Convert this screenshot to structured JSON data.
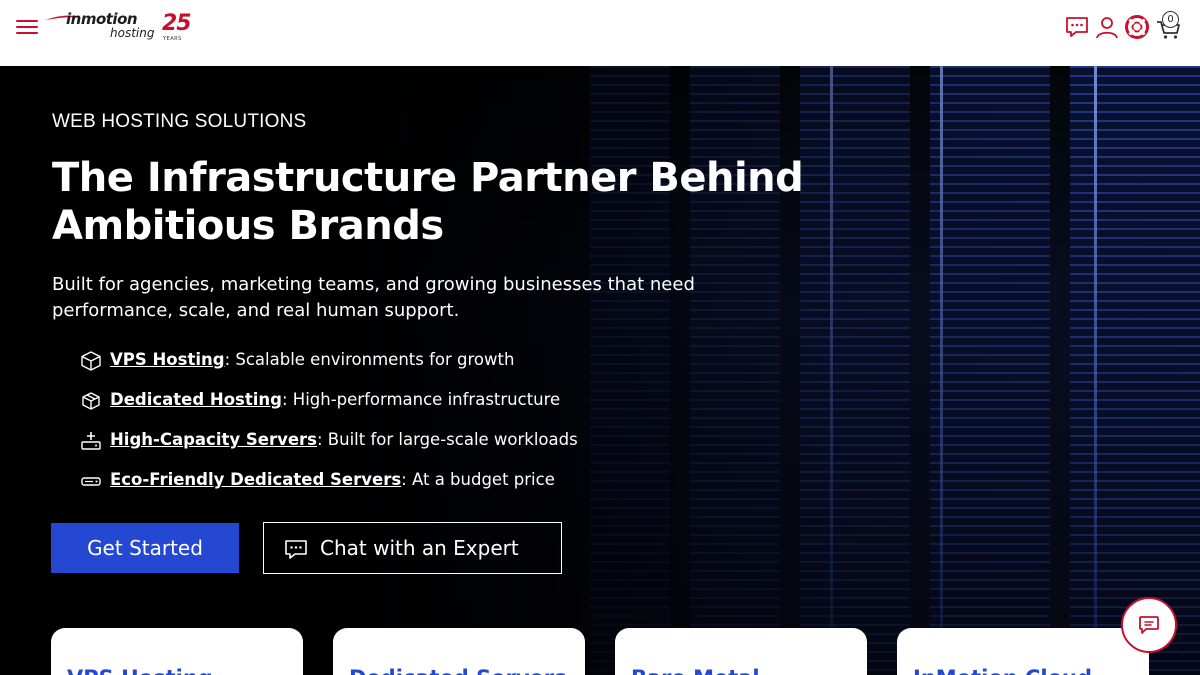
{
  "header": {
    "logo": {
      "brand": "inmotion",
      "sub": "hosting",
      "anniversary": "25",
      "anniversary_label": "YEARS"
    },
    "icons": [
      "chat-icon",
      "account-icon",
      "support-icon",
      "cart-icon"
    ],
    "cart_count": "0",
    "accent_color": "#c8102e"
  },
  "hero": {
    "eyebrow": "WEB HOSTING SOLUTIONS",
    "headline": "The Infrastructure Partner Behind Ambitious Brands",
    "subtext": "Built for agencies, marketing teams, and growing businesses that need performance, scale, and real human support.",
    "features": [
      {
        "icon": "cube-icon",
        "link": "VPS Hosting",
        "text": ": Scalable environments for growth"
      },
      {
        "icon": "box-icon",
        "link": "Dedicated Hosting",
        "text": ": High-performance infrastructure"
      },
      {
        "icon": "server-plus-icon",
        "link": "High-Capacity Servers",
        "text": ": Built for large-scale workloads"
      },
      {
        "icon": "server-drive-icon",
        "link": "Eco-Friendly Dedicated Servers",
        "text": ": At a budget price"
      }
    ],
    "primary_button": "Get Started",
    "secondary_button": "Chat with an Expert",
    "primary_color": "#2448d1"
  },
  "cards": [
    {
      "title": "VPS Hosting"
    },
    {
      "title": "Dedicated Servers"
    },
    {
      "title": "Bare Metal"
    },
    {
      "title": "InMotion Cloud"
    }
  ]
}
